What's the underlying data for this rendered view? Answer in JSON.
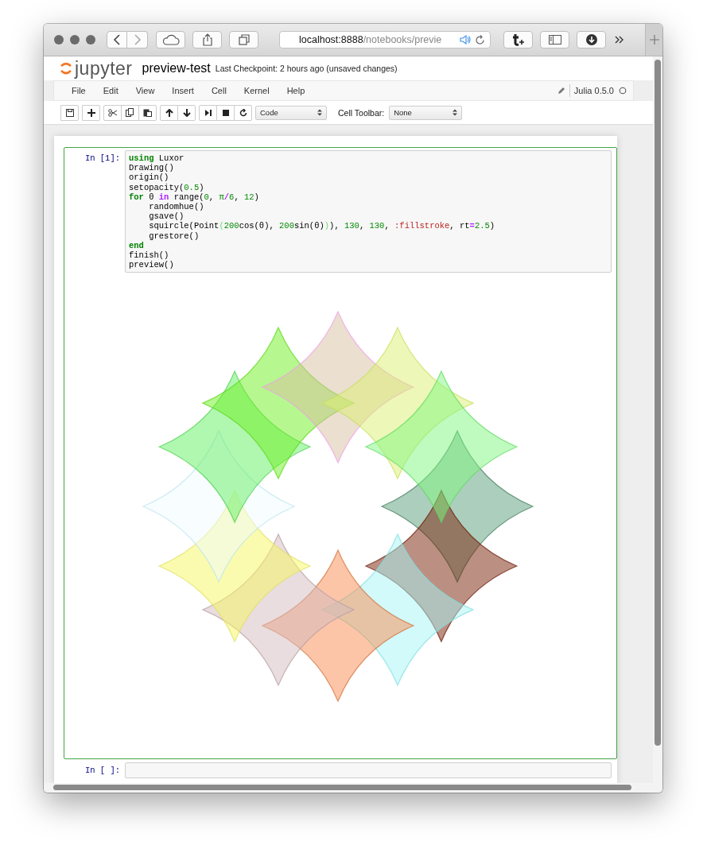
{
  "browser": {
    "address_host": "localhost:8888",
    "address_path": "/notebooks/previe"
  },
  "header": {
    "logo": "jupyter",
    "name": "preview-test",
    "checkpoint": "Last Checkpoint: 2 hours ago (unsaved changes)"
  },
  "menu": [
    "File",
    "Edit",
    "View",
    "Insert",
    "Cell",
    "Kernel",
    "Help"
  ],
  "kernel": "Julia 0.5.0",
  "toolbar": {
    "cell_type": "Code",
    "cell_toolbar_label": "Cell Toolbar:",
    "cell_toolbar": "None"
  },
  "cells": [
    {
      "prompt": "In [1]:",
      "selected": true,
      "output": {
        "kind": "drawing"
      },
      "lines": [
        [
          {
            "t": "using",
            "kind": "kw"
          },
          {
            "t": " Luxor",
            "kind": "plain"
          }
        ],
        [
          {
            "t": "Drawing()",
            "kind": "plain"
          }
        ],
        [
          {
            "t": "origin()",
            "kind": "plain"
          }
        ],
        [
          {
            "t": "setopacity(",
            "kind": "plain"
          },
          {
            "t": "0.5",
            "kind": "num"
          },
          {
            "t": ")",
            "kind": "plain"
          }
        ],
        [
          {
            "t": "for",
            "kind": "kw"
          },
          {
            "t": " θ ",
            "kind": "plain"
          },
          {
            "t": "in",
            "kind": "op"
          },
          {
            "t": " range(",
            "kind": "plain"
          },
          {
            "t": "0",
            "kind": "num"
          },
          {
            "t": ", ",
            "kind": "plain"
          },
          {
            "t": "π",
            "kind": "num"
          },
          {
            "t": "/",
            "kind": "op"
          },
          {
            "t": "6",
            "kind": "num"
          },
          {
            "t": ", ",
            "kind": "plain"
          },
          {
            "t": "12",
            "kind": "num"
          },
          {
            "t": ")",
            "kind": "plain"
          }
        ],
        [
          {
            "t": "    randomhue()",
            "kind": "plain"
          }
        ],
        [
          {
            "t": "    gsave()",
            "kind": "plain"
          }
        ],
        [
          {
            "t": "    squircle(Point",
            "kind": "plain"
          },
          {
            "t": "(",
            "kind": "bracket"
          },
          {
            "t": "200",
            "kind": "num"
          },
          {
            "t": "cos(θ), ",
            "kind": "plain"
          },
          {
            "t": "200",
            "kind": "num"
          },
          {
            "t": "sin(θ)",
            "kind": "plain"
          },
          {
            "t": ")",
            "kind": "bracket"
          },
          {
            "t": "), ",
            "kind": "plain"
          },
          {
            "t": "130",
            "kind": "num"
          },
          {
            "t": ", ",
            "kind": "plain"
          },
          {
            "t": "130",
            "kind": "num"
          },
          {
            "t": ", ",
            "kind": "plain"
          },
          {
            "t": ":fillstroke",
            "kind": "sym"
          },
          {
            "t": ", rt",
            "kind": "plain"
          },
          {
            "t": "=",
            "kind": "op"
          },
          {
            "t": "2.5",
            "kind": "num"
          },
          {
            "t": ")",
            "kind": "plain"
          }
        ],
        [
          {
            "t": "    grestore()",
            "kind": "plain"
          }
        ],
        [
          {
            "t": "end",
            "kind": "kw"
          }
        ],
        [
          {
            "t": "finish()",
            "kind": "plain"
          }
        ],
        [
          {
            "t": "preview()",
            "kind": "plain"
          }
        ]
      ]
    },
    {
      "prompt": "In [ ]:",
      "selected": false
    }
  ]
}
